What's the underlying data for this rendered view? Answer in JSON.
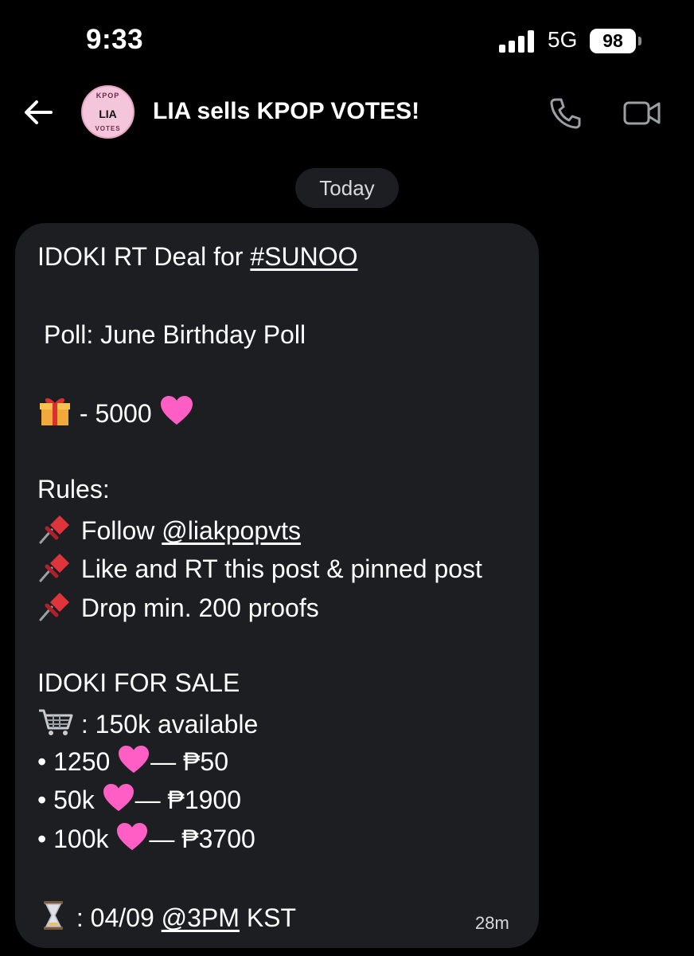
{
  "status_bar": {
    "time": "9:33",
    "network": "5G",
    "battery": "98"
  },
  "header": {
    "title": "LIA sells KPOP VOTES!",
    "avatar": {
      "top_text": "KPOP",
      "label": "LIA",
      "bottom_text": "VOTES"
    }
  },
  "date_separator": "Today",
  "message": {
    "deal_prefix": "IDOKI RT Deal for ",
    "deal_hashtag": "#SUNOO",
    "poll": "Poll: June Birthday Poll",
    "prize": "- 5000",
    "rules_heading": "Rules:",
    "rule_follow_prefix": "Follow ",
    "rule_follow_handle": "@liakpopvts",
    "rule_like": "Like and RT this post & pinned post",
    "rule_drop": "Drop min. 200 proofs",
    "sale_heading": "IDOKI FOR SALE",
    "available": ": 150k available",
    "price_items": [
      {
        "amount": "• 1250",
        "price": "— ₱50"
      },
      {
        "amount": "• 50k",
        "price": "— ₱1900"
      },
      {
        "amount": "• 100k",
        "price": "— ₱3700"
      }
    ],
    "deadline_prefix": ": 04/09 ",
    "deadline_time": "@3PM",
    "deadline_suffix": " KST",
    "timestamp": "28m"
  },
  "icons": {
    "gift": "gift-icon",
    "heart": "pink-heart-icon",
    "pin": "pushpin-icon",
    "cart": "shopping-cart-icon",
    "hourglass": "hourglass-icon"
  },
  "colors": {
    "background": "#000000",
    "bubble": "#1c1e22",
    "heart": "#ff5fc4",
    "pin": "#e0343c"
  }
}
